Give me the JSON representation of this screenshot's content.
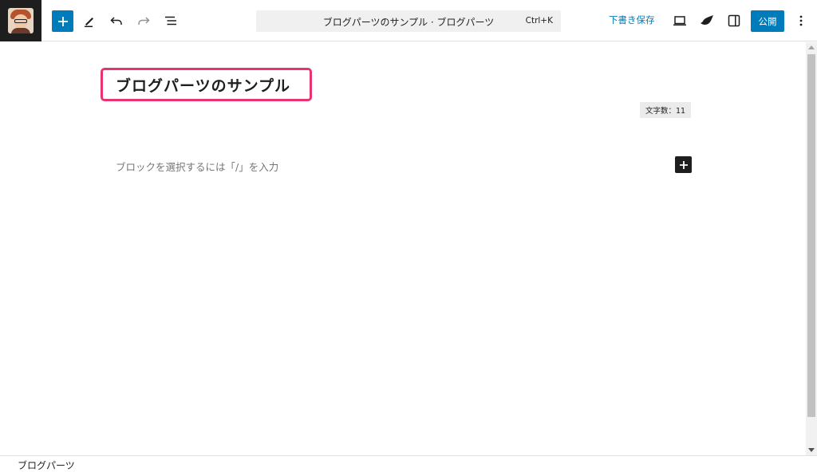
{
  "topbar": {
    "command_title": "ブログパーツのサンプル · ブログパーツ",
    "command_shortcut": "Ctrl+K",
    "save_draft": "下書き保存",
    "publish": "公開"
  },
  "editor": {
    "post_title": "ブログパーツのサンプル",
    "char_count": "文字数：11",
    "block_placeholder": "ブロックを選択するには「/」を入力"
  },
  "footer": {
    "breadcrumb": "ブログパーツ"
  },
  "icons": {
    "site": "site-logo-avatar",
    "add": "plus-icon",
    "tools": "pencil-icon",
    "undo": "undo-icon",
    "redo": "redo-icon",
    "outline": "list-view-icon",
    "preview": "laptop-icon",
    "theme": "leaf-icon",
    "settings": "sidebar-icon",
    "options": "kebab-icon"
  },
  "colors": {
    "accent": "#007cba",
    "highlight": "#e8336e"
  }
}
